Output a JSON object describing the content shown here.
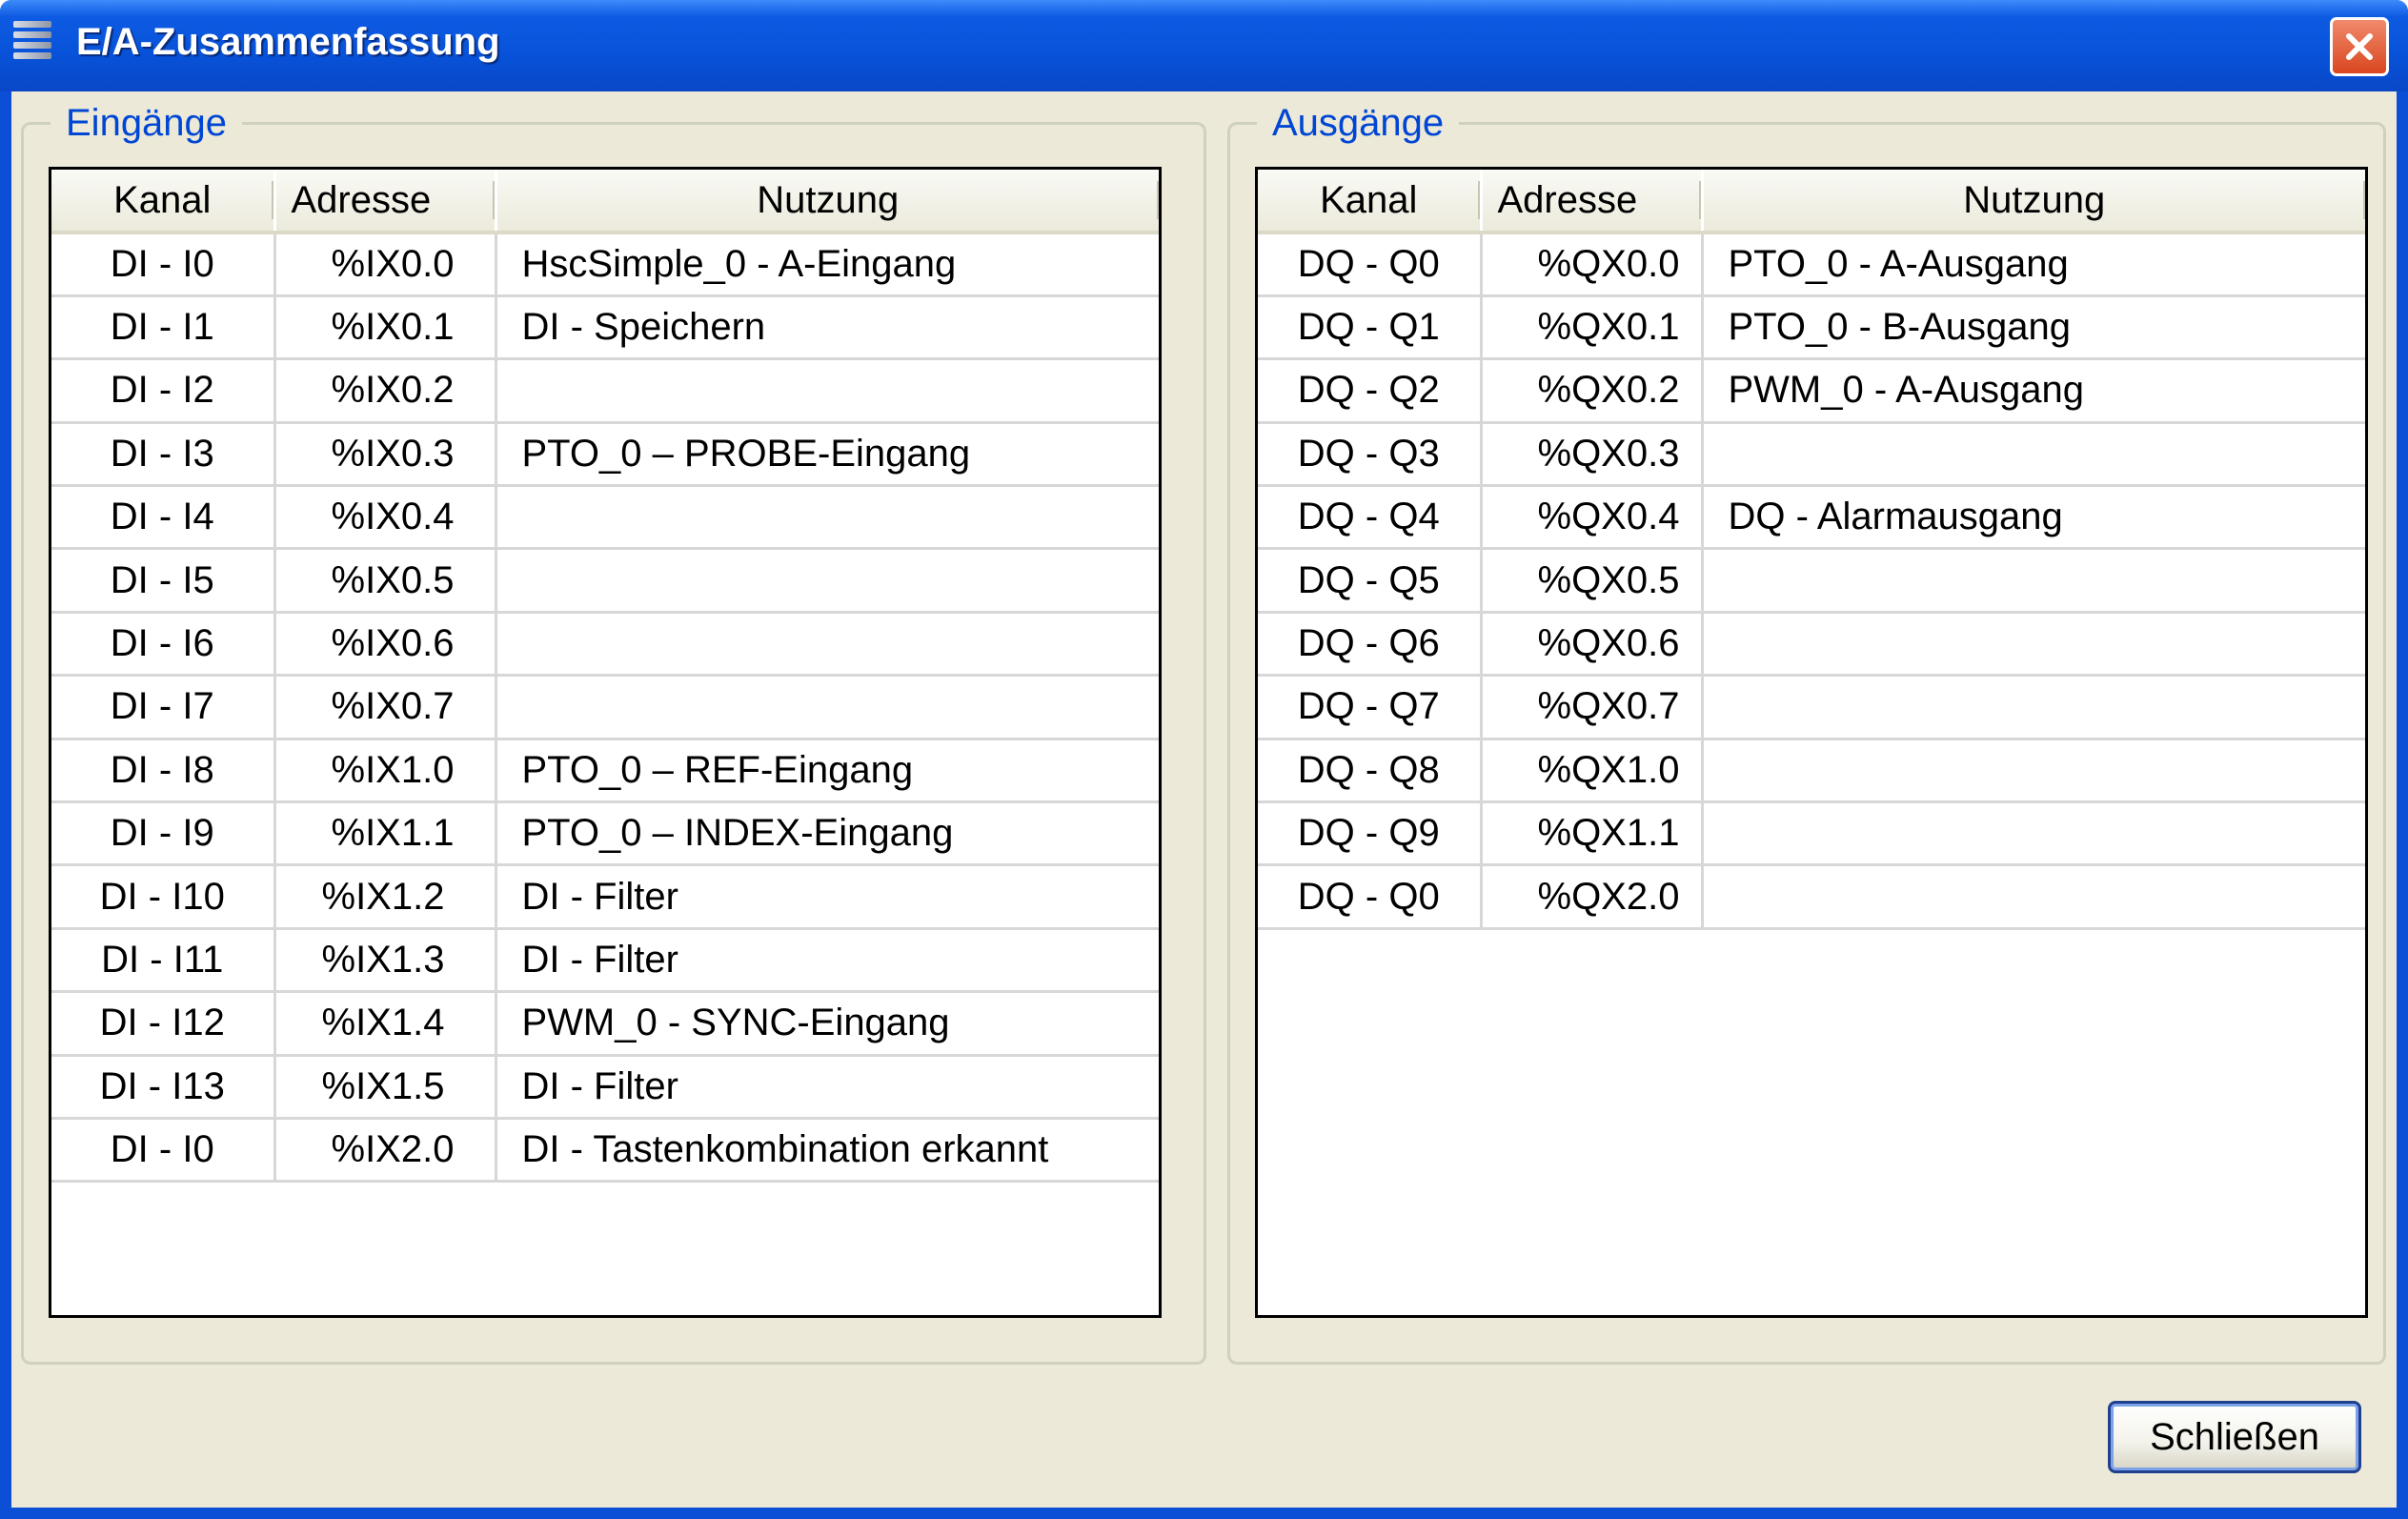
{
  "window": {
    "title": "E/A-Zusammenfassung"
  },
  "inputs": {
    "legend": "Eingänge",
    "headers": {
      "kanal": "Kanal",
      "adresse": "Adresse",
      "nutzung": "Nutzung"
    },
    "rows": [
      {
        "kanal": "DI - I0",
        "adresse": "%IX0.0",
        "nutzung": "HscSimple_0 - A-Eingang"
      },
      {
        "kanal": "DI - I1",
        "adresse": "%IX0.1",
        "nutzung": "DI - Speichern"
      },
      {
        "kanal": "DI - I2",
        "adresse": "%IX0.2",
        "nutzung": ""
      },
      {
        "kanal": "DI - I3",
        "adresse": "%IX0.3",
        "nutzung": "PTO_0 – PROBE-Eingang"
      },
      {
        "kanal": "DI - I4",
        "adresse": "%IX0.4",
        "nutzung": ""
      },
      {
        "kanal": "DI - I5",
        "adresse": "%IX0.5",
        "nutzung": ""
      },
      {
        "kanal": "DI - I6",
        "adresse": "%IX0.6",
        "nutzung": ""
      },
      {
        "kanal": "DI - I7",
        "adresse": "%IX0.7",
        "nutzung": ""
      },
      {
        "kanal": "DI - I8",
        "adresse": "%IX1.0",
        "nutzung": "PTO_0 – REF-Eingang"
      },
      {
        "kanal": "DI - I9",
        "adresse": "%IX1.1",
        "nutzung": "PTO_0 – INDEX-Eingang"
      },
      {
        "kanal": "DI - I10",
        "adresse": "%IX1.2",
        "nutzung": "DI - Filter"
      },
      {
        "kanal": "DI - I11",
        "adresse": "%IX1.3",
        "nutzung": "DI - Filter"
      },
      {
        "kanal": "DI - I12",
        "adresse": "%IX1.4",
        "nutzung": "PWM_0 - SYNC-Eingang"
      },
      {
        "kanal": "DI - I13",
        "adresse": "%IX1.5",
        "nutzung": "DI - Filter"
      },
      {
        "kanal": "DI - I0",
        "adresse": "%IX2.0",
        "nutzung": "DI - Tastenkombination erkannt"
      }
    ]
  },
  "outputs": {
    "legend": "Ausgänge",
    "headers": {
      "kanal": "Kanal",
      "adresse": "Adresse",
      "nutzung": "Nutzung"
    },
    "rows": [
      {
        "kanal": "DQ - Q0",
        "adresse": "%QX0.0",
        "nutzung": "PTO_0 - A-Ausgang"
      },
      {
        "kanal": "DQ - Q1",
        "adresse": "%QX0.1",
        "nutzung": "PTO_0 - B-Ausgang"
      },
      {
        "kanal": "DQ - Q2",
        "adresse": "%QX0.2",
        "nutzung": "PWM_0 - A-Ausgang"
      },
      {
        "kanal": "DQ - Q3",
        "adresse": "%QX0.3",
        "nutzung": ""
      },
      {
        "kanal": "DQ - Q4",
        "adresse": "%QX0.4",
        "nutzung": "DQ - Alarmausgang"
      },
      {
        "kanal": "DQ - Q5",
        "adresse": "%QX0.5",
        "nutzung": ""
      },
      {
        "kanal": "DQ - Q6",
        "adresse": "%QX0.6",
        "nutzung": ""
      },
      {
        "kanal": "DQ - Q7",
        "adresse": "%QX0.7",
        "nutzung": ""
      },
      {
        "kanal": "DQ - Q8",
        "adresse": "%QX1.0",
        "nutzung": ""
      },
      {
        "kanal": "DQ - Q9",
        "adresse": "%QX1.1",
        "nutzung": ""
      },
      {
        "kanal": "DQ - Q0",
        "adresse": "%QX2.0",
        "nutzung": ""
      }
    ]
  },
  "footer": {
    "close_label": "Schließen"
  },
  "icons": {
    "app": "app-menu-icon",
    "close": "close-icon"
  },
  "colors": {
    "titlebar": "#0752d8",
    "client_background": "#ece9d8",
    "legend_text": "#0046d5",
    "close_button": "#d9461f"
  }
}
